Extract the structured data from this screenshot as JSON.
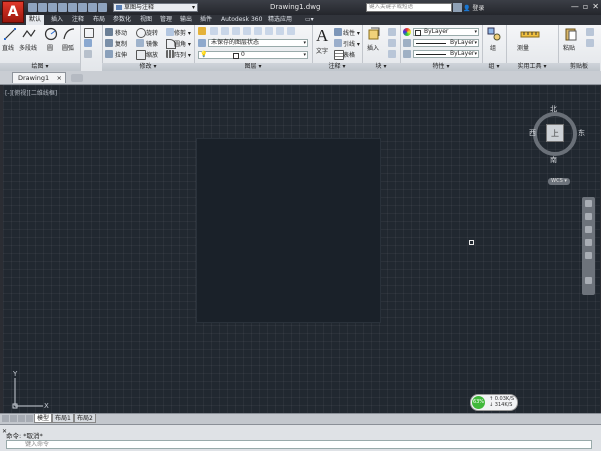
{
  "app": {
    "logo": "A",
    "title": "Drawing1.dwg"
  },
  "workspace": {
    "selected": "草图与注释"
  },
  "search": {
    "placeholder": "键入关键字或短语"
  },
  "user": {
    "login": "登录"
  },
  "window_controls": {
    "minimize": "—",
    "restore": "▫",
    "close": "✕"
  },
  "ribbon_tabs": [
    "默认",
    "插入",
    "注释",
    "布局",
    "参数化",
    "视图",
    "管理",
    "输出",
    "插件",
    "Autodesk 360",
    "精选应用",
    "▭▾"
  ],
  "active_ribbon_tab": 0,
  "panels": {
    "draw": {
      "title": "绘图 ▾",
      "line": "直线",
      "polyline": "多段线",
      "circle": "圆",
      "arc": "圆弧"
    },
    "modify": {
      "title": "修改 ▾",
      "move": "移动",
      "rotate": "旋转",
      "trim": "修剪 ▾",
      "copy": "复制",
      "mirror": "镜像",
      "fillet": "圆角 ▾",
      "stretch": "拉伸",
      "scale": "缩放",
      "array": "阵列 ▾"
    },
    "layers": {
      "title": "图层 ▾",
      "layer_state": "未保存的图层状态",
      "layer_value": "0"
    },
    "annotation": {
      "title": "注释 ▾",
      "text": "文字",
      "linear": "线性 ▾",
      "leader": "引线 ▾",
      "table": "表格"
    },
    "block": {
      "title": "块 ▾",
      "insert": "插入"
    },
    "properties": {
      "title": "特性 ▾",
      "color": "ByLayer",
      "linetype": "ByLayer",
      "lineweight": "ByLayer"
    },
    "groups": {
      "title": "组 ▾",
      "group": "组"
    },
    "utilities": {
      "title": "实用工具 ▾",
      "measure": "测量"
    },
    "clipboard": {
      "title": "剪贴板",
      "paste": "粘贴"
    }
  },
  "file_tab": {
    "label": "Drawing1",
    "close": "×"
  },
  "viewport": {
    "label": "[-][俯视][二维线框]"
  },
  "viewcube": {
    "north": "北",
    "south": "南",
    "west": "西",
    "east": "东",
    "face": "上",
    "wcs": "WCS ▾"
  },
  "ucs": {
    "x": "X",
    "y": "Y"
  },
  "network": {
    "percent": "63%",
    "up": "↑ 0.03K/S",
    "down": "↓ 314K/S"
  },
  "layout_tabs": [
    "模型",
    "布局1",
    "布局2"
  ],
  "active_layout": 0,
  "command": {
    "output": "命令: *取消*",
    "placeholder": "键入命令"
  },
  "colors": {
    "ribbon_bg": "#eceef1",
    "canvas_bg": "#212830",
    "title_bar": "#2c2f36",
    "accent": "#c62a1e"
  }
}
